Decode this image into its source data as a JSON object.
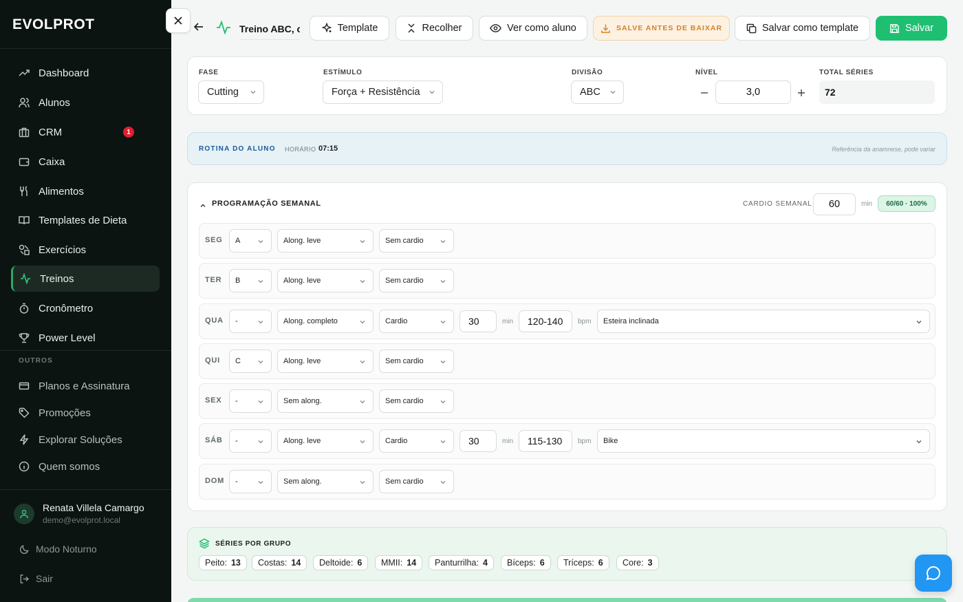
{
  "brand": {
    "logo_text": "EVOLPROT"
  },
  "sidebar": {
    "items": [
      {
        "label": "Dashboard",
        "icon": "trend-icon"
      },
      {
        "label": "Alunos",
        "icon": "users-icon"
      },
      {
        "label": "CRM",
        "icon": "briefcase-icon",
        "badge": "1"
      },
      {
        "label": "Caixa",
        "icon": "wallet-icon"
      },
      {
        "label": "Alimentos",
        "icon": "utensils-icon"
      },
      {
        "label": "Templates de Dieta",
        "icon": "book-icon"
      },
      {
        "label": "Exercícios",
        "icon": "shapes-icon"
      },
      {
        "label": "Treinos",
        "icon": "activity-icon",
        "active": true
      },
      {
        "label": "Cronômetro",
        "icon": "timer-icon"
      },
      {
        "label": "Power Level",
        "icon": "trophy-icon"
      }
    ],
    "section_label": "OUTROS",
    "other_items": [
      {
        "label": "Planos e Assinatura",
        "icon": "card-icon"
      },
      {
        "label": "Promoções",
        "icon": "tag-icon"
      },
      {
        "label": "Explorar Soluções",
        "icon": "bolt-icon"
      },
      {
        "label": "Quem somos",
        "icon": "info-icon"
      }
    ],
    "user": {
      "name": "Renata Villela Camargo",
      "email": "demo@evolprot.local"
    },
    "dark_mode_label": "Modo Noturno",
    "logout_label": "Sair"
  },
  "toolbar": {
    "title": "Treino ABC, c",
    "template_label": "Template",
    "collapse_label": "Recolher",
    "view_as_student_label": "Ver como aluno",
    "save_before_download_label": "SALVE ANTES DE BAIXAR",
    "save_as_template_label": "Salvar como template",
    "save_label": "Salvar"
  },
  "params": {
    "fase_label": "FASE",
    "fase_value": "Cutting",
    "estimulo_label": "ESTÍMULO",
    "estimulo_value": "Força + Resistência",
    "divisao_label": "DIVISÃO",
    "divisao_value": "ABC",
    "nivel_label": "NÍVEL",
    "nivel_value": "3,0",
    "total_label": "TOTAL SÉRIES",
    "total_value": "72"
  },
  "rotina": {
    "title": "ROTINA DO ALUNO",
    "horario_label": "HORÁRIO",
    "horario_value": "07:15",
    "note": "Referência da anamnese, pode variar"
  },
  "schedule": {
    "title": "PROGRAMAÇÃO SEMANAL",
    "cardio_label": "CARDIO SEMANAL",
    "cardio_value": "60",
    "cardio_unit": "min",
    "cardio_badge": "60/60 · 100%",
    "min_unit": "min",
    "bpm_unit": "bpm",
    "days": [
      {
        "day": "SEG",
        "treino": "A",
        "along": "Along. leve",
        "cardio": "Sem cardio"
      },
      {
        "day": "TER",
        "treino": "B",
        "along": "Along. leve",
        "cardio": "Sem cardio"
      },
      {
        "day": "QUA",
        "treino": "-",
        "along": "Along. completo",
        "cardio": "Cardio",
        "minutes": "30",
        "bpm": "120-140",
        "modality": "Esteira inclinada"
      },
      {
        "day": "QUI",
        "treino": "C",
        "along": "Along. leve",
        "cardio": "Sem cardio"
      },
      {
        "day": "SEX",
        "treino": "-",
        "along": "Sem along.",
        "cardio": "Sem cardio"
      },
      {
        "day": "SÁB",
        "treino": "-",
        "along": "Along. leve",
        "cardio": "Cardio",
        "minutes": "30",
        "bpm": "115-130",
        "modality": "Bike"
      },
      {
        "day": "DOM",
        "treino": "-",
        "along": "Sem along.",
        "cardio": "Sem cardio"
      }
    ]
  },
  "series_by_group": {
    "title": "SÉRIES POR GRUPO",
    "groups": [
      {
        "name": "Peito:",
        "value": "13"
      },
      {
        "name": "Costas:",
        "value": "14"
      },
      {
        "name": "Deltoide:",
        "value": "6"
      },
      {
        "name": "MMII:",
        "value": "14"
      },
      {
        "name": "Panturrilha:",
        "value": "4"
      },
      {
        "name": "Bíceps:",
        "value": "6"
      },
      {
        "name": "Tríceps:",
        "value": "6"
      },
      {
        "name": "Core:",
        "value": "3"
      }
    ]
  },
  "colors": {
    "accent": "#1fbf72",
    "sidebar_bg": "#0b1410",
    "warn": "#d4822a",
    "info": "#1b5a9a",
    "chat": "#2196f3"
  }
}
